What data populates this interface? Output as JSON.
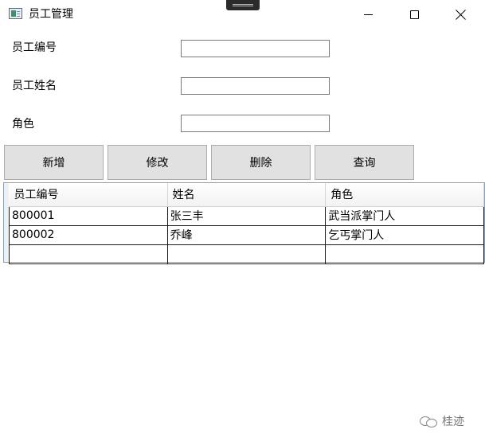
{
  "window": {
    "title": "员工管理",
    "icon": "app-window-icon"
  },
  "form": {
    "fields": [
      {
        "label": "员工编号",
        "value": ""
      },
      {
        "label": "员工姓名",
        "value": ""
      },
      {
        "label": "角色",
        "value": ""
      }
    ]
  },
  "toolbar": {
    "buttons": [
      "新增",
      "修改",
      "删除",
      "查询"
    ]
  },
  "grid": {
    "columns": [
      "员工编号",
      "姓名",
      "角色"
    ],
    "rows": [
      [
        "800001",
        "张三丰",
        "武当派掌门人"
      ],
      [
        "800002",
        "乔峰",
        "乞丐掌门人"
      ],
      [
        "",
        "",
        ""
      ]
    ]
  },
  "watermark": {
    "text": "桂迹",
    "icon": "wechat-icon"
  }
}
